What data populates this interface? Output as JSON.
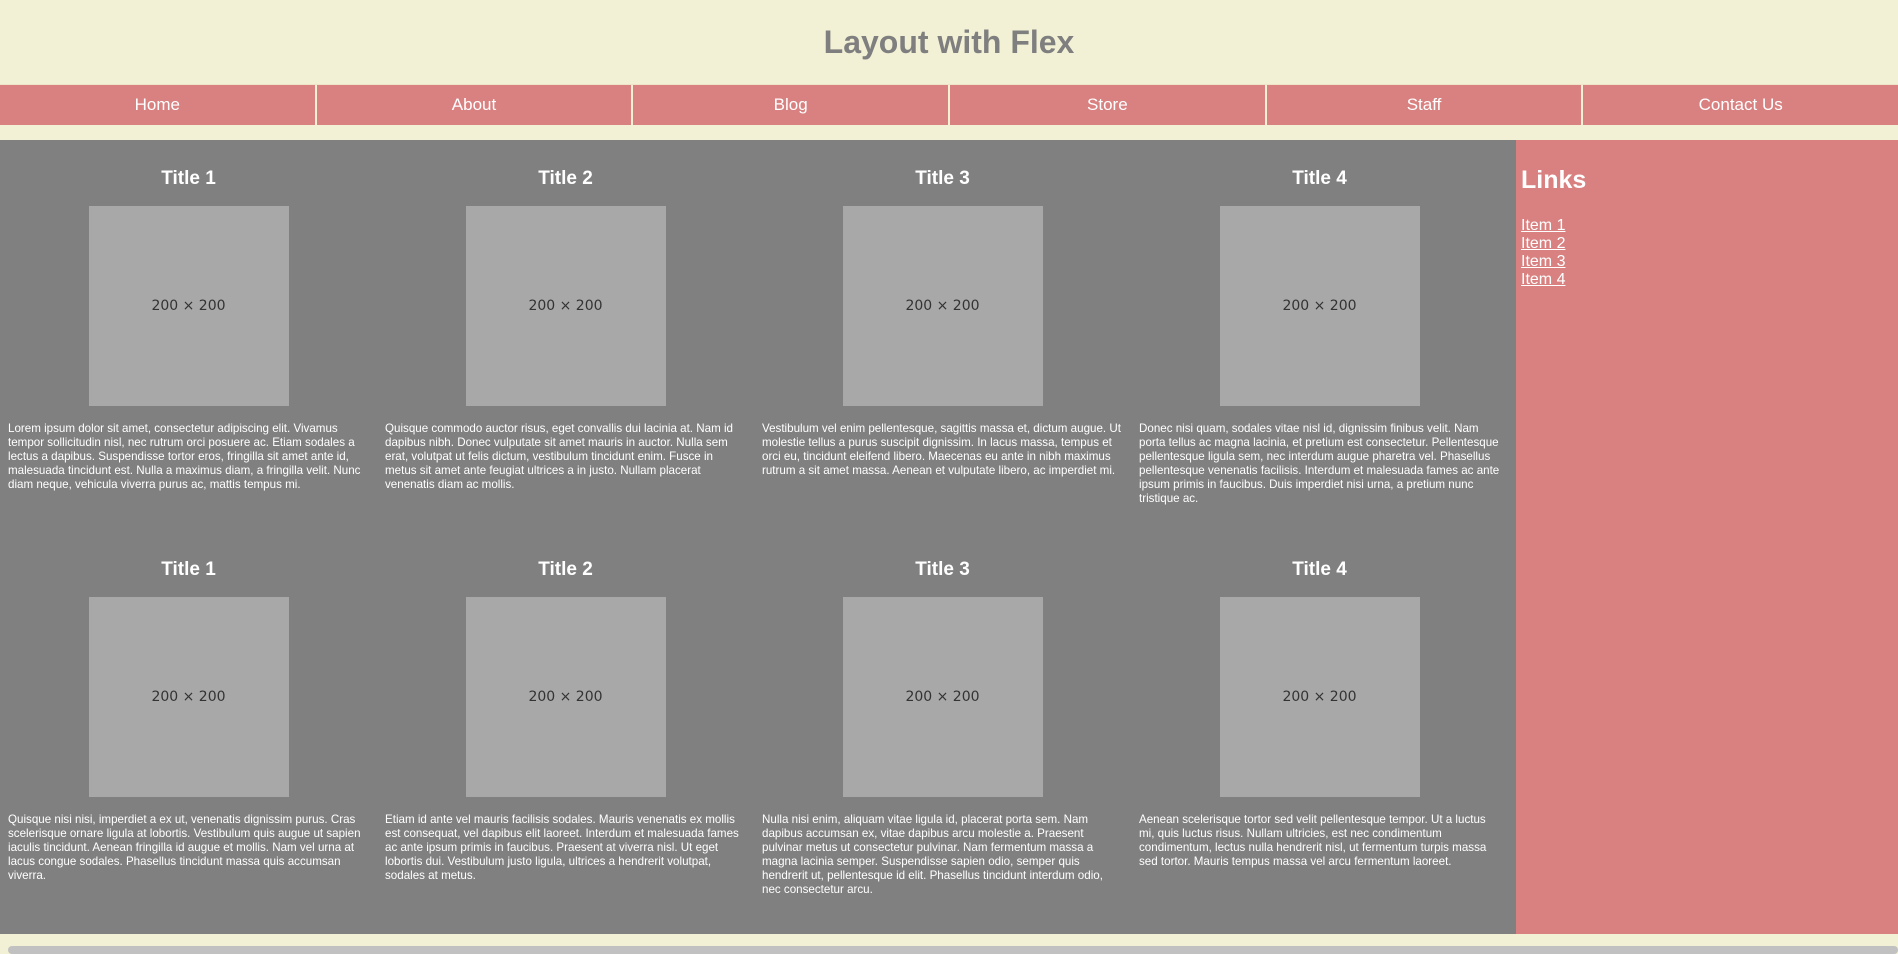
{
  "header": {
    "title": "Layout with Flex"
  },
  "nav": {
    "items": [
      "Home",
      "About",
      "Blog",
      "Store",
      "Staff",
      "Contact Us"
    ]
  },
  "cards": [
    {
      "title": "Title 1",
      "image_label": "200 × 200",
      "text": "Lorem ipsum dolor sit amet, consectetur adipiscing elit. Vivamus tempor sollicitudin nisl, nec rutrum orci posuere ac. Etiam sodales a lectus a dapibus. Suspendisse tortor eros, fringilla sit amet ante id, malesuada tincidunt est. Nulla a maximus diam, a fringilla velit. Nunc diam neque, vehicula viverra purus ac, mattis tempus mi."
    },
    {
      "title": "Title 2",
      "image_label": "200 × 200",
      "text": "Quisque commodo auctor risus, eget convallis dui lacinia at. Nam id dapibus nibh. Donec vulputate sit amet mauris in auctor. Nulla sem erat, volutpat ut felis dictum, vestibulum tincidunt enim. Fusce in metus sit amet ante feugiat ultrices a in justo. Nullam placerat venenatis diam ac mollis."
    },
    {
      "title": "Title 3",
      "image_label": "200 × 200",
      "text": "Vestibulum vel enim pellentesque, sagittis massa et, dictum augue. Ut molestie tellus a purus suscipit dignissim. In lacus massa, tempus et orci eu, tincidunt eleifend libero. Maecenas eu ante in nibh maximus rutrum a sit amet massa. Aenean et vulputate libero, ac imperdiet mi."
    },
    {
      "title": "Title 4",
      "image_label": "200 × 200",
      "text": "Donec nisi quam, sodales vitae nisl id, dignissim finibus velit. Nam porta tellus ac magna lacinia, et pretium est consectetur. Pellentesque pellentesque ligula sem, nec interdum augue pharetra vel. Phasellus pellentesque venenatis facilisis. Interdum et malesuada fames ac ante ipsum primis in faucibus. Duis imperdiet nisi urna, a pretium nunc tristique ac."
    },
    {
      "title": "Title 1",
      "image_label": "200 × 200",
      "text": "Quisque nisi nisi, imperdiet a ex ut, venenatis dignissim purus. Cras scelerisque ornare ligula at lobortis. Vestibulum quis augue ut sapien iaculis tincidunt. Aenean fringilla id augue et mollis. Nam vel urna at lacus congue sodales. Phasellus tincidunt massa quis accumsan viverra."
    },
    {
      "title": "Title 2",
      "image_label": "200 × 200",
      "text": "Etiam id ante vel mauris facilisis sodales. Mauris venenatis ex mollis est consequat, vel dapibus elit laoreet. Interdum et malesuada fames ac ante ipsum primis in faucibus. Praesent at viverra nisl. Ut eget lobortis dui. Vestibulum justo ligula, ultrices a hendrerit volutpat, sodales at metus."
    },
    {
      "title": "Title 3",
      "image_label": "200 × 200",
      "text": "Nulla nisi enim, aliquam vitae ligula id, placerat porta sem. Nam dapibus accumsan ex, vitae dapibus arcu molestie a. Praesent pulvinar metus ut consectetur pulvinar. Nam fermentum massa a magna lacinia semper. Suspendisse sapien odio, semper quis hendrerit ut, pellentesque id elit. Phasellus tincidunt interdum odio, nec consectetur arcu."
    },
    {
      "title": "Title 4",
      "image_label": "200 × 200",
      "text": "Aenean scelerisque tortor sed velit pellentesque tempor. Ut a luctus mi, quis luctus risus. Nullam ultricies, est nec condimentum condimentum, lectus nulla hendrerit nisl, ut fermentum turpis massa sed tortor. Mauris tempus massa vel arcu fermentum laoreet."
    }
  ],
  "sidebar": {
    "title": "Links",
    "items": [
      "Item 1",
      "Item 2",
      "Item 3",
      "Item 4"
    ]
  }
}
